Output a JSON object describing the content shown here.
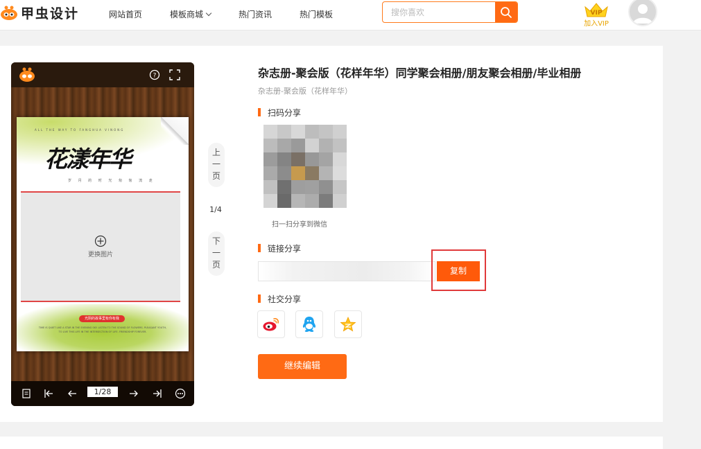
{
  "header": {
    "logo_text": "甲虫设计",
    "nav": [
      {
        "label": "网站首页"
      },
      {
        "label": "模板商城",
        "has_dropdown": true
      },
      {
        "label": "热门资讯"
      },
      {
        "label": "热门模板"
      }
    ],
    "search": {
      "placeholder": "搜你喜欢",
      "value": ""
    },
    "vip": {
      "badge": "VIP",
      "label": "加入VIP"
    }
  },
  "preview": {
    "page_tagline": "ALL THE WAY TO FANGHUA VINONG",
    "page_title": "花漾年华",
    "page_subtitle": "岁 月 的 时 光 匆 匆 流 走",
    "photo_placeholder": "更换图片",
    "page_bottom_label": "光阴的故事里有你有我",
    "page_bottom_text": "TIME IS QUIET LIKE A STAR IN THE EVENING SKY. LISTEN TO THE SOUND OF FLOWERS. PLEASANT YOUTH, TO LIVE THIS LIFE IN THE INTERSECTION OF LIFE. FRIENDSHIP FOREVER.",
    "counter": "1/28",
    "controls": [
      "list-icon",
      "first-page-icon",
      "prev-icon",
      "next-icon",
      "last-page-icon",
      "more-icon"
    ]
  },
  "pager": {
    "prev": [
      "上",
      "一",
      "页"
    ],
    "next": [
      "下",
      "一",
      "页"
    ],
    "position": "1/4"
  },
  "info": {
    "title": "杂志册-聚会版（花样年华）同学聚会相册/朋友聚会相册/毕业相册",
    "subtitle": "杂志册-聚会版（花样年华）",
    "qr_heading": "扫码分享",
    "qr_caption": "扫一扫分享到微信",
    "link_heading": "链接分享",
    "link_value": "",
    "copy_label": "复制",
    "social_heading": "社交分享",
    "social": [
      "weibo-icon",
      "qq-icon",
      "qzone-icon"
    ],
    "continue_label": "继续编辑"
  },
  "colors": {
    "accent": "#ff6a14",
    "highlight_frame": "#e0393a",
    "vip_gold": "#e8a400"
  },
  "qr_cells": [
    "#d6d6d6",
    "#c8c8c8",
    "#d8d8d8",
    "#bdbdbd",
    "#c4c4c4",
    "#d0d0d0",
    "#bcbcbc",
    "#a8a8a8",
    "#9a9a9a",
    "#d2d2d2",
    "#b2b2b2",
    "#c2c2c2",
    "#9c9c9c",
    "#848484",
    "#7a7066",
    "#989898",
    "#a4a4a4",
    "#d8d8d8",
    "#aaaaaa",
    "#8c8c8c",
    "#c69a4e",
    "#8a7a62",
    "#b4b4b4",
    "#dcdcdc",
    "#c0c0c0",
    "#707070",
    "#9e9e9e",
    "#a0a0a0",
    "#909090",
    "#c6c6c6",
    "#d4d4d4",
    "#6a6a6a",
    "#b6b6b6",
    "#acacac",
    "#7c7c7c",
    "#d0d0d0"
  ]
}
